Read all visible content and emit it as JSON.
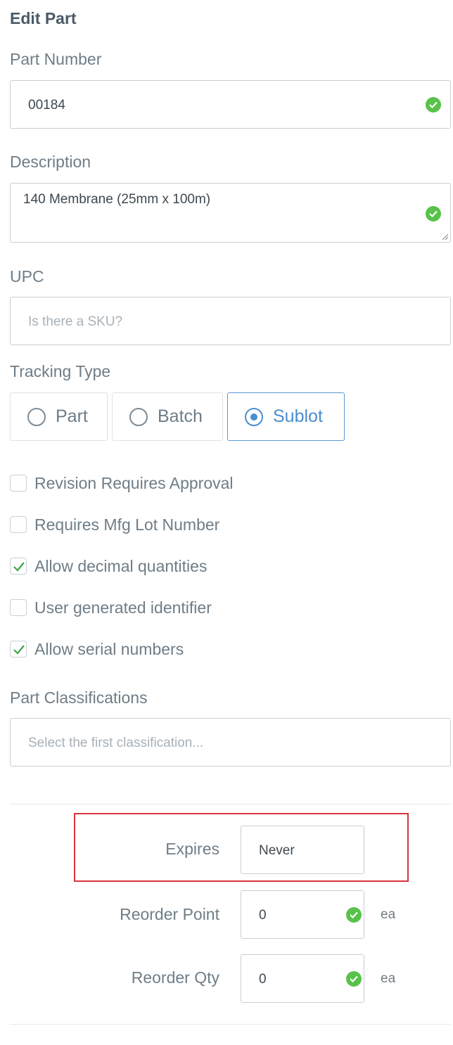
{
  "form": {
    "title": "Edit Part",
    "part_number": {
      "label": "Part Number",
      "value": "00184"
    },
    "description": {
      "label": "Description",
      "value": "140 Membrane (25mm x 100m)"
    },
    "upc": {
      "label": "UPC",
      "placeholder": "Is there a SKU?"
    },
    "tracking_type": {
      "label": "Tracking Type",
      "options": [
        {
          "label": "Part",
          "selected": false
        },
        {
          "label": "Batch",
          "selected": false
        },
        {
          "label": "Sublot",
          "selected": true
        }
      ]
    },
    "checkboxes": [
      {
        "label": "Revision Requires Approval",
        "checked": false
      },
      {
        "label": "Requires Mfg Lot Number",
        "checked": false
      },
      {
        "label": "Allow decimal quantities",
        "checked": true
      },
      {
        "label": "User generated identifier",
        "checked": false
      },
      {
        "label": "Allow serial numbers",
        "checked": true
      }
    ],
    "classifications": {
      "label": "Part Classifications",
      "placeholder": "Select the first classification..."
    },
    "expires": {
      "label": "Expires",
      "value": "Never"
    },
    "reorder_point": {
      "label": "Reorder Point",
      "value": "0",
      "unit": "ea"
    },
    "reorder_qty": {
      "label": "Reorder Qty",
      "value": "0",
      "unit": "ea"
    }
  },
  "colors": {
    "accent": "#4a8ed0",
    "valid": "#58c24a",
    "highlight": "#d9343b",
    "checkmark": "#3fa44a"
  }
}
